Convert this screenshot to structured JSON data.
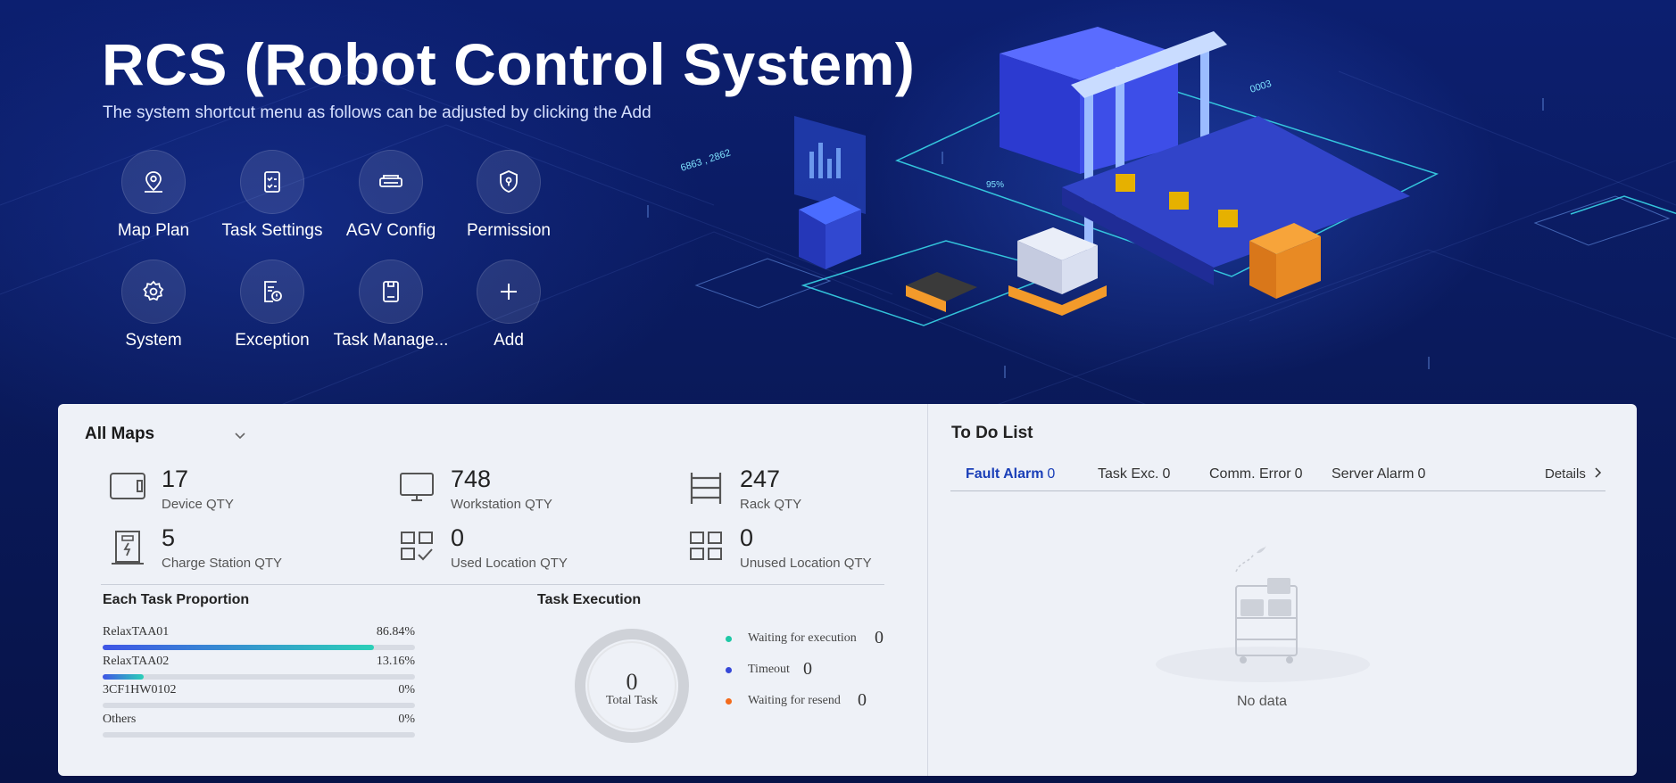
{
  "hero": {
    "title": "RCS (Robot Control System)",
    "subtitle": "The system shortcut menu as follows can be adjusted by clicking the Add",
    "shortcuts": [
      {
        "label": "Map Plan",
        "icon": "map-pin-icon"
      },
      {
        "label": "Task Settings",
        "icon": "checklist-icon"
      },
      {
        "label": "AGV Config",
        "icon": "agv-icon"
      },
      {
        "label": "Permission",
        "icon": "shield-icon"
      },
      {
        "label": "System",
        "icon": "gear-icon"
      },
      {
        "label": "Exception",
        "icon": "exception-doc-icon"
      },
      {
        "label": "Task Manage...",
        "icon": "document-icon"
      },
      {
        "label": "Add",
        "icon": "plus-icon"
      }
    ],
    "scene_labels": {
      "coords": "6863 , 2862",
      "percent": "95%",
      "code": "0003"
    }
  },
  "maps": {
    "selected": "All Maps",
    "stats": [
      {
        "value": "17",
        "label": "Device QTY",
        "icon": "device-icon"
      },
      {
        "value": "748",
        "label": "Workstation QTY",
        "icon": "monitor-icon"
      },
      {
        "value": "247",
        "label": "Rack QTY",
        "icon": "rack-icon"
      },
      {
        "value": "5",
        "label": "Charge Station QTY",
        "icon": "charge-station-icon"
      },
      {
        "value": "0",
        "label": "Used Location QTY",
        "icon": "used-location-icon"
      },
      {
        "value": "0",
        "label": "Unused Location QTY",
        "icon": "unused-location-icon"
      }
    ]
  },
  "proportion": {
    "title": "Each Task Proportion",
    "rows": [
      {
        "name": "RelaxTAA01",
        "pct_label": "86.84%",
        "pct": 86.84
      },
      {
        "name": "RelaxTAA02",
        "pct_label": "13.16%",
        "pct": 13.16
      },
      {
        "name": "3CF1HW0102",
        "pct_label": "0%",
        "pct": 0
      },
      {
        "name": "Others",
        "pct_label": "0%",
        "pct": 0
      }
    ]
  },
  "execution": {
    "title": "Task Execution",
    "total": "0",
    "total_label": "Total Task",
    "legend": [
      {
        "label": "Waiting for execution",
        "value": "0",
        "color": "#1fc8a6"
      },
      {
        "label": "Timeout",
        "value": "0",
        "color": "#3648d8"
      },
      {
        "label": "Waiting for resend",
        "value": "0",
        "color": "#f36b1c"
      }
    ]
  },
  "todo": {
    "title": "To Do List",
    "tabs": [
      {
        "label": "Fault Alarm",
        "count": "0"
      },
      {
        "label": "Task Exc.",
        "count": "0"
      },
      {
        "label": "Comm. Error",
        "count": "0"
      },
      {
        "label": "Server Alarm",
        "count": "0"
      }
    ],
    "details": "Details",
    "empty_text": "No data"
  },
  "colors": {
    "accent": "#1a3fb8",
    "bar_start": "#3f55e6",
    "bar_end": "#2bd0b8",
    "hero_bg": "#0a1d66"
  }
}
